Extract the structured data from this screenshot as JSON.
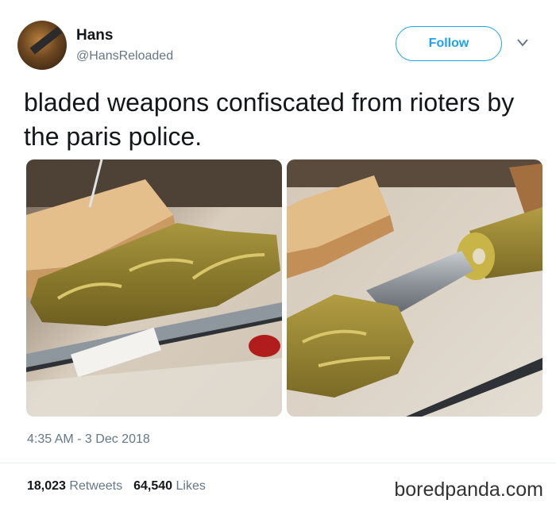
{
  "author": {
    "name": "Hans",
    "handle": "@HansReloaded"
  },
  "follow_label": "Follow",
  "tweet_text": "bladed weapons confiscated from rioters by the paris police.",
  "timestamp": "4:35 AM - 3 Dec 2018",
  "stats": {
    "retweets_count": "18,023",
    "retweets_label": "Retweets",
    "likes_count": "64,540",
    "likes_label": "Likes"
  },
  "watermark": "boredpanda.com",
  "colors": {
    "accent": "#1da1f2",
    "muted": "#657786",
    "text": "#14171a"
  }
}
